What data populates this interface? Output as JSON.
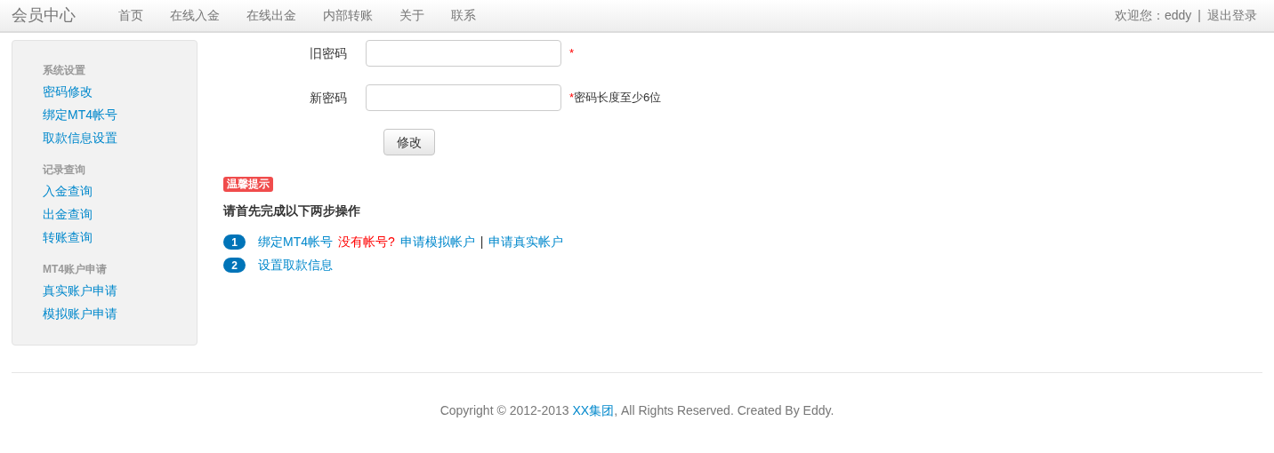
{
  "navbar": {
    "brand": "会员中心",
    "items": [
      {
        "label": "首页"
      },
      {
        "label": "在线入金"
      },
      {
        "label": "在线出金"
      },
      {
        "label": "内部转账"
      },
      {
        "label": "关于"
      },
      {
        "label": "联系"
      }
    ],
    "welcome": "欢迎您：eddy",
    "separator": "|",
    "logout": "退出登录"
  },
  "sidebar": {
    "sections": [
      {
        "title": "系统设置",
        "items": [
          "密码修改",
          "绑定MT4帐号",
          "取款信息设置"
        ]
      },
      {
        "title": "记录查询",
        "items": [
          "入金查询",
          "出金查询",
          "转账查询"
        ]
      },
      {
        "title": "MT4账户申请",
        "items": [
          "真实账户申请",
          "模拟账户申请"
        ]
      }
    ]
  },
  "form": {
    "fields": [
      {
        "label": "旧密码",
        "required_mark": "*"
      },
      {
        "label": "新密码",
        "required_mark": "*",
        "hint": "密码长度至少6位"
      }
    ],
    "submit": "修改"
  },
  "notice": {
    "badge": "温馨提示",
    "heading": "请首先完成以下两步操作",
    "steps": [
      {
        "number": "1",
        "parts": [
          {
            "kind": "link",
            "text": "绑定MT4帐号"
          },
          {
            "kind": "warning",
            "text": "没有帐号?"
          },
          {
            "kind": "link",
            "text": "申请模拟帐户"
          },
          {
            "kind": "separator",
            "text": "|"
          },
          {
            "kind": "link",
            "text": "申请真实帐户"
          }
        ]
      },
      {
        "number": "2",
        "parts": [
          {
            "kind": "link",
            "text": "设置取款信息"
          }
        ]
      }
    ]
  },
  "footer": {
    "before": "Copyright © 2012-2013 ",
    "link": "XX集团",
    "after": ", All Rights Reserved. Created By Eddy."
  }
}
